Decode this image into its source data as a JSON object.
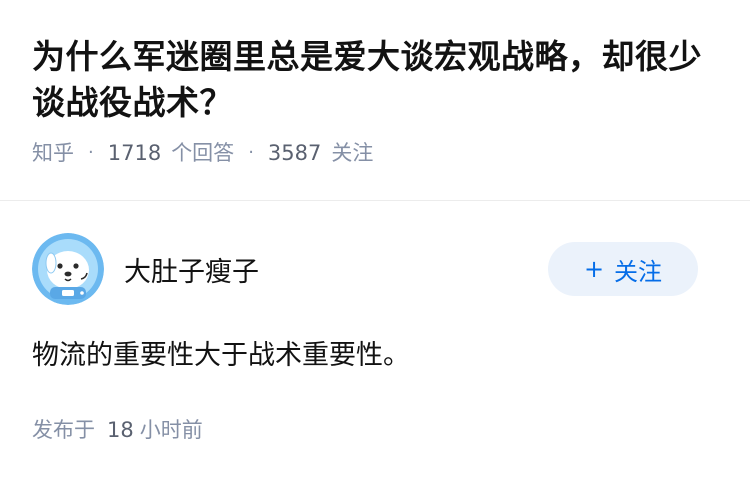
{
  "question": {
    "title": "为什么军迷圈里总是爱大谈宏观战略，却很少谈战役战术？",
    "source": "知乎",
    "separator": "·",
    "answer_count": "1718",
    "answer_label": "个回答",
    "follower_count": "3587",
    "follower_label": "关注"
  },
  "answer": {
    "author_name": "大肚子瘦子",
    "follow_plus": "+",
    "follow_label": "关注",
    "content": "物流的重要性大于战术重要性。",
    "published_label": "发布于",
    "published_value": "18",
    "published_unit": "小时前"
  },
  "colors": {
    "accent": "#056de8",
    "follow_bg": "#ebf2fb",
    "meta_text": "#8590a6",
    "avatar_bg": "#6cb9f0"
  },
  "icons": {
    "avatar": "dog-astronaut-avatar-icon"
  }
}
